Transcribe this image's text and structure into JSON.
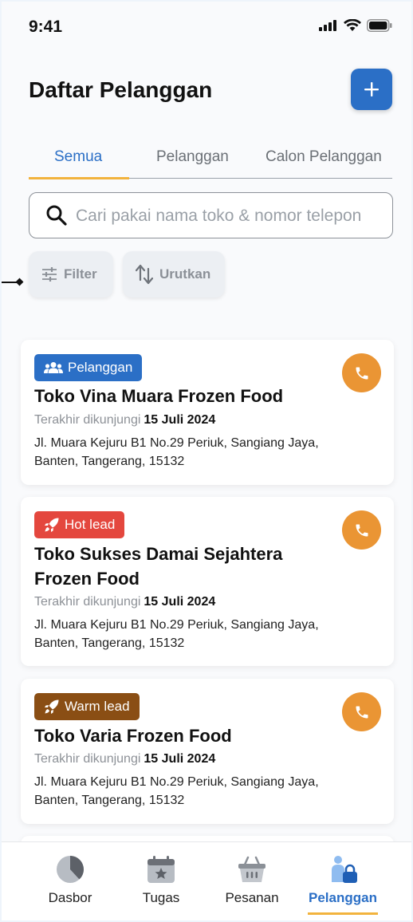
{
  "status": {
    "time": "9:41"
  },
  "header": {
    "title": "Daftar Pelanggan",
    "add_icon": "plus-icon"
  },
  "tabs": [
    {
      "label": "Semua",
      "active": true
    },
    {
      "label": "Pelanggan",
      "active": false
    },
    {
      "label": "Calon Pelanggan",
      "active": false
    }
  ],
  "search": {
    "placeholder": "Cari pakai nama toko & nomor telepon"
  },
  "chips": {
    "filter": "Filter",
    "sort": "Urutkan"
  },
  "customers": [
    {
      "badge": "Pelanggan",
      "badge_color": "#2b6fc6",
      "badge_icon": "users-icon",
      "name": "Toko Vina Muara Frozen Food",
      "visit_label": "Terakhir dikunjungi",
      "visit_date": "15 Juli 2024",
      "address": "Jl. Muara Kejuru B1 No.29 Periuk, Sangiang Jaya, Banten, Tangerang, 15132"
    },
    {
      "badge": "Hot lead",
      "badge_color": "#e4473e",
      "badge_icon": "rocket-icon",
      "name": "Toko Sukses Damai Sejahtera Frozen Food",
      "visit_label": "Terakhir dikunjungi",
      "visit_date": "15 Juli 2024",
      "address": "Jl. Muara Kejuru B1 No.29 Periuk, Sangiang Jaya, Banten, Tangerang, 15132"
    },
    {
      "badge": "Warm lead",
      "badge_color": "#8a4e14",
      "badge_icon": "rocket-icon",
      "name": "Toko Varia Frozen Food",
      "visit_label": "Terakhir dikunjungi",
      "visit_date": "15 Juli 2024",
      "address": "Jl. Muara Kejuru B1 No.29 Periuk, Sangiang Jaya, Banten, Tangerang, 15132"
    }
  ],
  "nav": [
    {
      "label": "Dasbor",
      "icon": "pie-chart-icon",
      "active": false
    },
    {
      "label": "Tugas",
      "icon": "calendar-star-icon",
      "active": false
    },
    {
      "label": "Pesanan",
      "icon": "basket-icon",
      "active": false
    },
    {
      "label": "Pelanggan",
      "icon": "customer-lock-icon",
      "active": true
    }
  ],
  "colors": {
    "primary": "#2b6fc6",
    "accent": "#f2b33d",
    "call": "#ea9534"
  }
}
